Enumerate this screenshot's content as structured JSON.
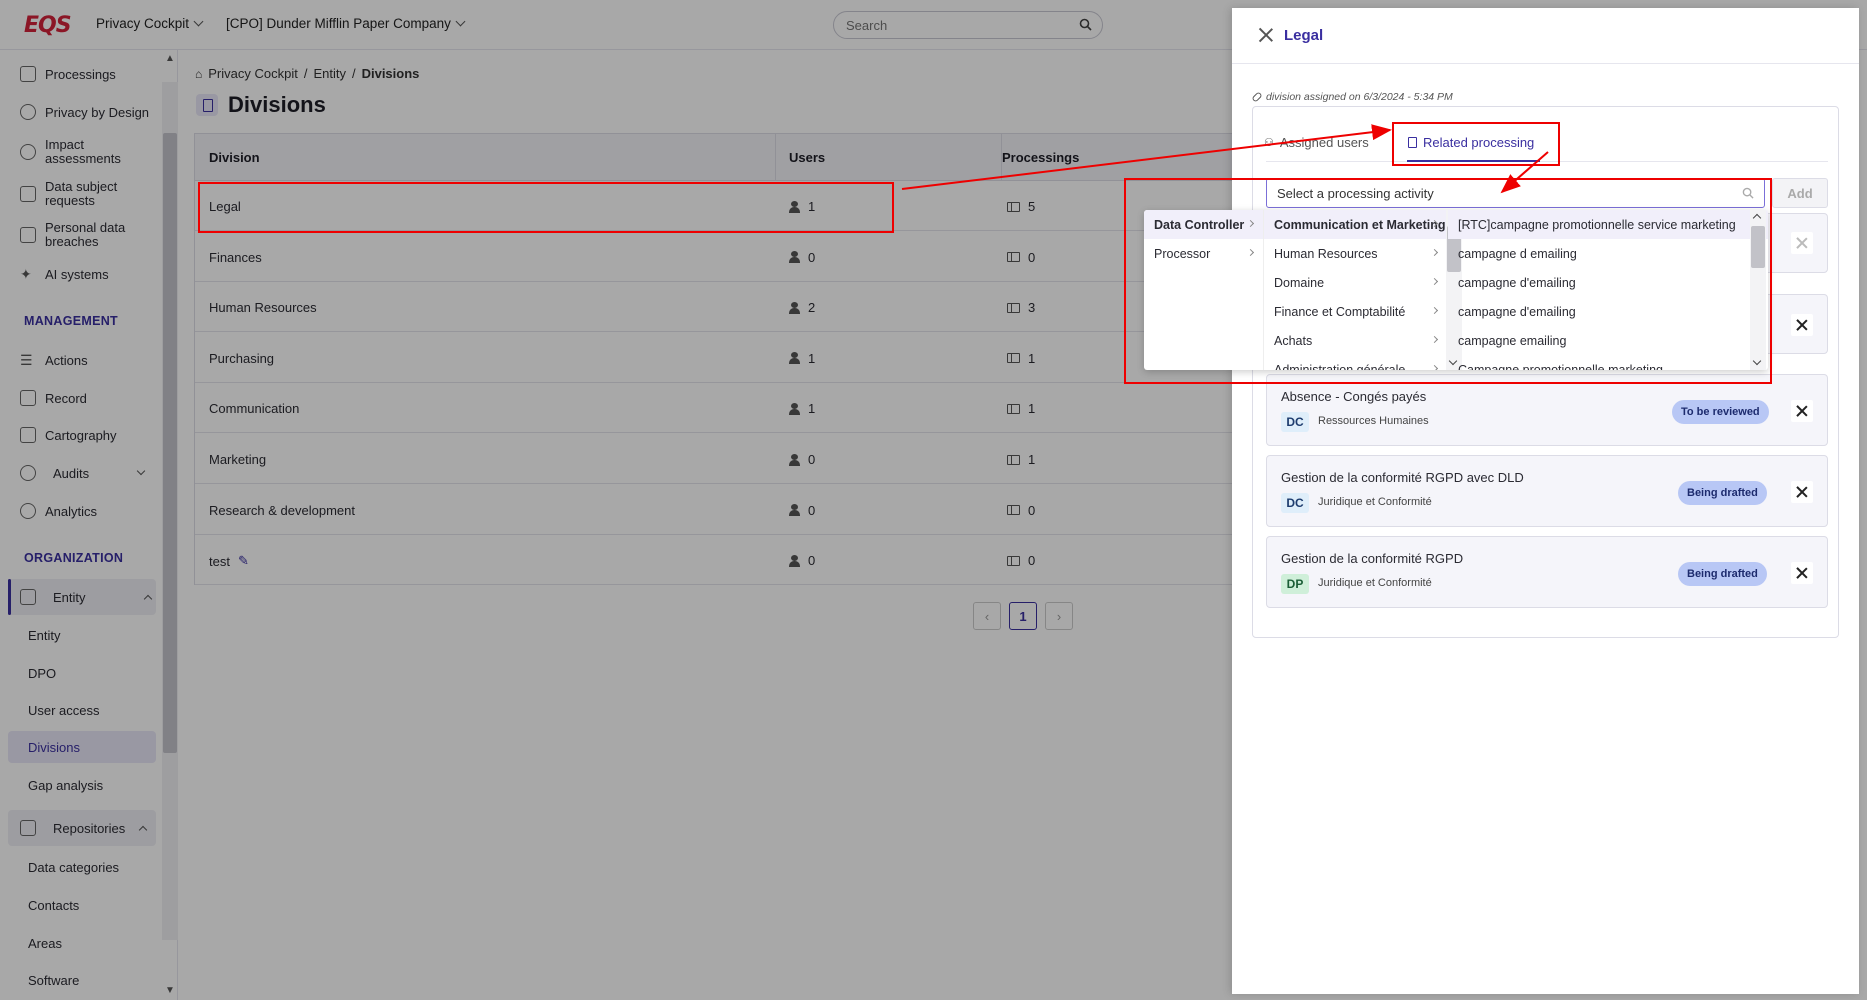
{
  "topbar": {
    "logo": "EQS",
    "app_switch": "Privacy Cockpit",
    "company_switch": "[CPO] Dunder Mifflin Paper Company",
    "search_placeholder": "Search"
  },
  "sidebar": {
    "items": [
      {
        "label": "Processings"
      },
      {
        "label": "Privacy by Design"
      },
      {
        "label": "Impact assessments"
      },
      {
        "label": "Data subject requests"
      },
      {
        "label": "Personal data breaches"
      },
      {
        "label": "AI systems"
      }
    ],
    "management_title": "MANAGEMENT",
    "management": [
      {
        "label": "Actions"
      },
      {
        "label": "Record"
      },
      {
        "label": "Cartography"
      },
      {
        "label": "Audits"
      },
      {
        "label": "Analytics"
      }
    ],
    "organization_title": "ORGANIZATION",
    "entity_group": "Entity",
    "entity_sub": [
      "Entity",
      "DPO",
      "User access",
      "Divisions",
      "Gap analysis"
    ],
    "repositories_group": "Repositories",
    "repositories_sub": [
      "Data categories",
      "Contacts",
      "Areas",
      "Software"
    ]
  },
  "main": {
    "breadcrumb": [
      "Privacy Cockpit",
      "Entity",
      "Divisions"
    ],
    "title": "Divisions",
    "headers": [
      "Division",
      "Users",
      "Processings"
    ],
    "rows": [
      {
        "division": "Legal",
        "users": "1",
        "processings": "5"
      },
      {
        "division": "Finances",
        "users": "0",
        "processings": "0"
      },
      {
        "division": "Human Resources",
        "users": "2",
        "processings": "3"
      },
      {
        "division": "Purchasing",
        "users": "1",
        "processings": "1"
      },
      {
        "division": "Communication",
        "users": "1",
        "processings": "1"
      },
      {
        "division": "Marketing",
        "users": "0",
        "processings": "1"
      },
      {
        "division": "Research & development",
        "users": "0",
        "processings": "0"
      },
      {
        "division": "test",
        "users": "0",
        "processings": "0"
      }
    ],
    "page": "1"
  },
  "drawer": {
    "title": "Legal",
    "assigned_note": "division assigned on 6/3/2024 - 5:34 PM",
    "tab_users": "Assigned users",
    "tab_processing": "Related processing",
    "select_placeholder": "Select a processing activity",
    "add_label": "Add",
    "cards": [
      {
        "title": "Absence - Congés payés",
        "role": "DC",
        "dept": "Ressources Humaines",
        "status": "To be reviewed"
      },
      {
        "title": "Gestion de la conformité RGPD avec DLD",
        "role": "DC",
        "dept": "Juridique et Conformité",
        "status": "Being drafted"
      },
      {
        "title": "Gestion de la conformité RGPD",
        "role": "DP",
        "dept": "Juridique et Conformité",
        "status": "Being drafted"
      }
    ]
  },
  "cascader": {
    "level1": [
      "Data Controller",
      "Processor"
    ],
    "level2": [
      "Communication et Marketing",
      "Human Resources",
      "Domaine",
      "Finance et Comptabilité",
      "Achats",
      "Administration générale"
    ],
    "level3": [
      "[RTC]campagne promotionnelle service marketing",
      "campagne d emailing",
      "campagne d'emailing",
      "campagne d'emailing",
      "campagne emailing",
      "Campagne promotionnelle marketing"
    ]
  },
  "colors": {
    "accent": "#3a2fa0",
    "logo": "#d3223b",
    "annotation": "#ee0000",
    "status_badge": "#b8c7f5"
  }
}
